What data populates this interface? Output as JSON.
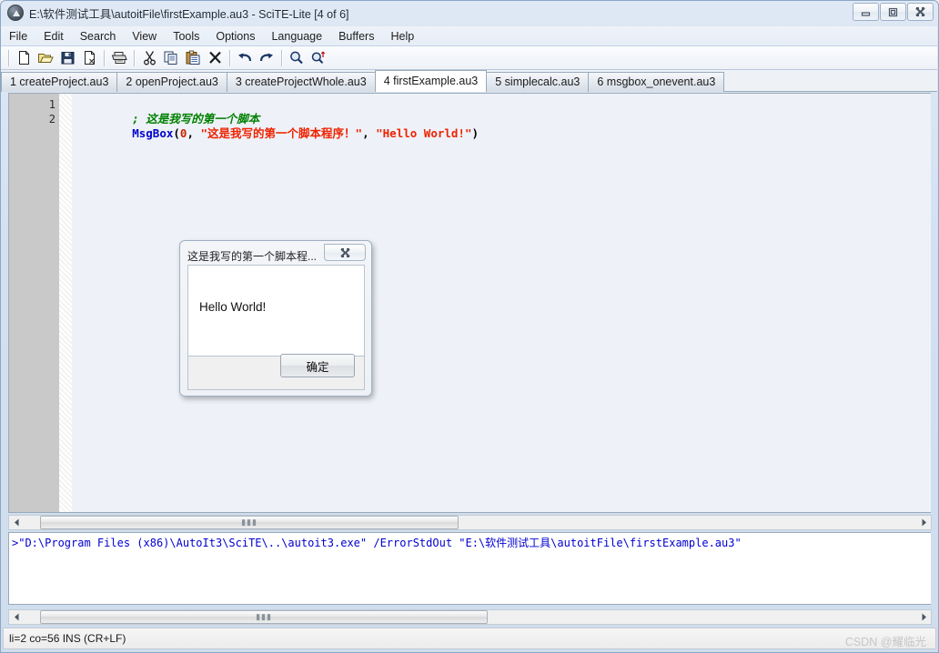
{
  "window": {
    "title": "E:\\软件测试工具\\autoitFile\\firstExample.au3 - SciTE-Lite [4 of 6]",
    "icon": "autoit-app-icon",
    "controls": {
      "minimize": "minimize-icon",
      "maximize": "maximize-icon",
      "close": "close-icon"
    }
  },
  "menubar": {
    "items": [
      {
        "label": "File"
      },
      {
        "label": "Edit"
      },
      {
        "label": "Search"
      },
      {
        "label": "View"
      },
      {
        "label": "Tools"
      },
      {
        "label": "Options"
      },
      {
        "label": "Language"
      },
      {
        "label": "Buffers"
      },
      {
        "label": "Help"
      }
    ]
  },
  "toolbar": {
    "buttons": [
      {
        "name": "new-file-icon",
        "title": "New"
      },
      {
        "name": "open-file-icon",
        "title": "Open"
      },
      {
        "name": "save-file-icon",
        "title": "Save"
      },
      {
        "name": "close-file-icon",
        "title": "Close"
      },
      {
        "name": "print-icon",
        "title": "Print"
      },
      {
        "name": "cut-icon",
        "title": "Cut"
      },
      {
        "name": "copy-icon",
        "title": "Copy"
      },
      {
        "name": "paste-icon",
        "title": "Paste"
      },
      {
        "name": "delete-icon",
        "title": "Delete"
      },
      {
        "name": "undo-icon",
        "title": "Undo"
      },
      {
        "name": "redo-icon",
        "title": "Redo"
      },
      {
        "name": "find-icon",
        "title": "Find"
      },
      {
        "name": "replace-icon",
        "title": "Replace"
      }
    ]
  },
  "tabs": {
    "active_index": 3,
    "items": [
      {
        "label": "1 createProject.au3"
      },
      {
        "label": "2 openProject.au3"
      },
      {
        "label": "3 createProjectWhole.au3"
      },
      {
        "label": "4 firstExample.au3"
      },
      {
        "label": "5 simplecalc.au3"
      },
      {
        "label": "6 msgbox_onevent.au3"
      }
    ]
  },
  "editor": {
    "line_numbers": [
      "1",
      "2"
    ],
    "lines": [
      {
        "tokens": [
          {
            "text": "; 这是我写的第一个脚本",
            "style": "comment"
          }
        ]
      },
      {
        "tokens": [
          {
            "text": "MsgBox",
            "style": "func"
          },
          {
            "text": "(",
            "style": "punct"
          },
          {
            "text": "0",
            "style": "num"
          },
          {
            "text": ", ",
            "style": "punct"
          },
          {
            "text": "\"这是我写的第一个脚本程序！\"",
            "style": "str"
          },
          {
            "text": ", ",
            "style": "punct"
          },
          {
            "text": "\"Hello World!\"",
            "style": "str"
          },
          {
            "text": ")",
            "style": "punct"
          }
        ]
      }
    ]
  },
  "console": {
    "lines": [
      ">\"D:\\Program Files (x86)\\AutoIt3\\SciTE\\..\\autoit3.exe\" /ErrorStdOut \"E:\\软件测试工具\\autoitFile\\firstExample.au3\""
    ]
  },
  "statusbar": {
    "text": "li=2 co=56 INS (CR+LF)",
    "watermark": "CSDN @耀临光"
  },
  "dialog": {
    "title": "这是我写的第一个脚本程...",
    "close_icon": "close-icon",
    "message": "Hello World!",
    "ok_label": "确定"
  },
  "scrollbars": {
    "editor_h": {
      "left_arrow": "scroll-left-icon",
      "right_arrow": "scroll-right-icon",
      "grip": "▮▮▮"
    },
    "console_h": {
      "left_arrow": "scroll-left-icon",
      "right_arrow": "scroll-right-icon",
      "grip": "▮▮▮"
    }
  },
  "colors": {
    "comment": "#008000",
    "function": "#0000cc",
    "number": "#cc2200",
    "string": "#ee2200",
    "console_text": "#0000d0",
    "line_margin": "#c9c9c9",
    "editor_bg": "#eef2f8"
  }
}
